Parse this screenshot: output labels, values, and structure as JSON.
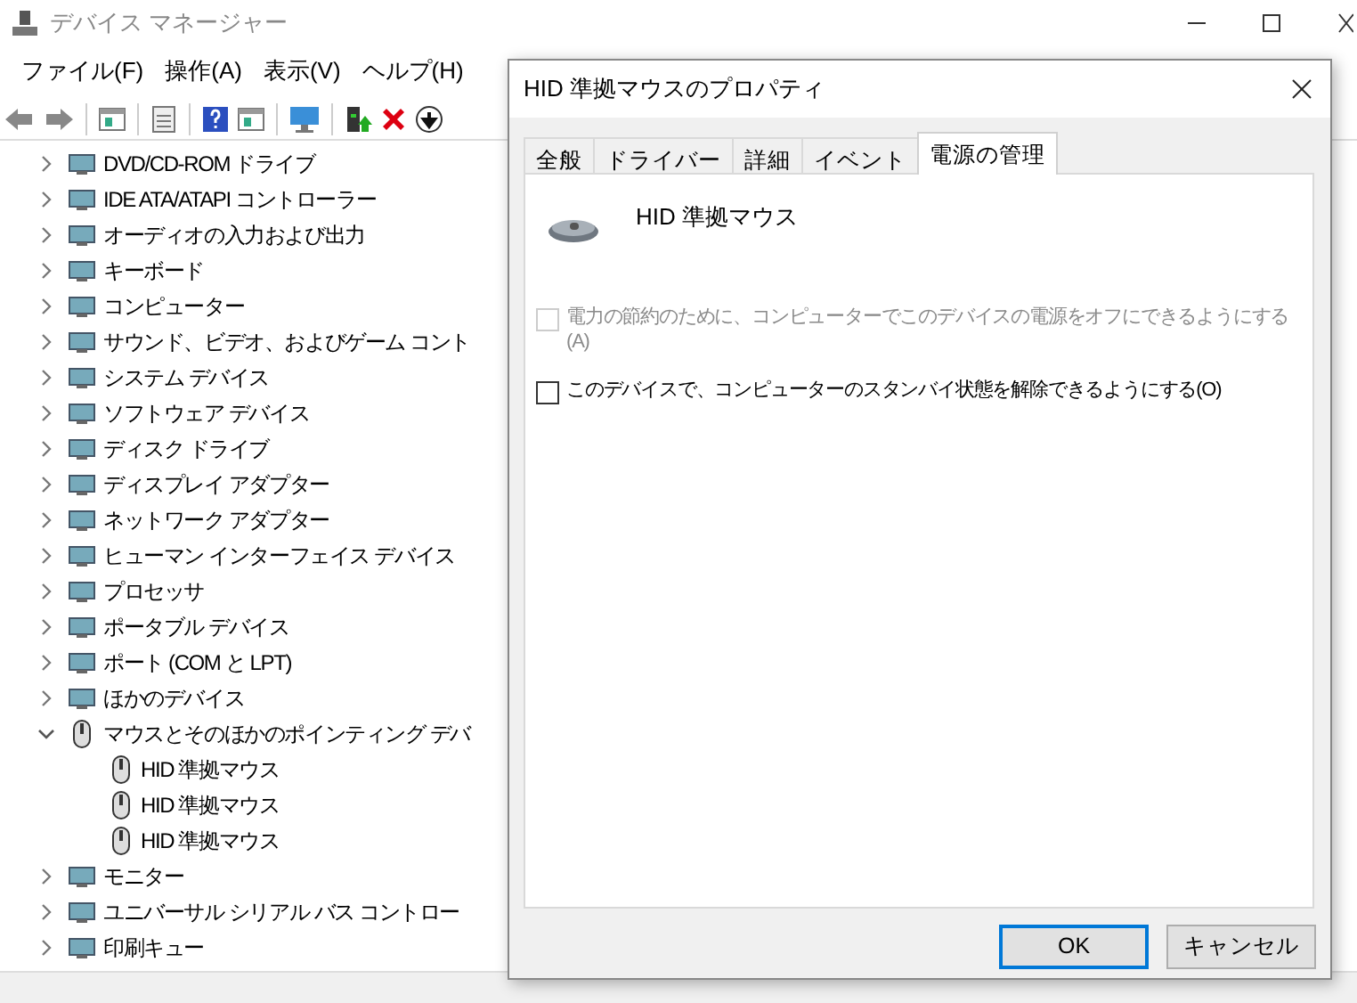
{
  "window": {
    "title": "デバイス マネージャー"
  },
  "menu": [
    "ファイル(F)",
    "操作(A)",
    "表示(V)",
    "ヘルプ(H)"
  ],
  "tree": [
    {
      "label": "DVD/CD-ROM ドライブ",
      "expanded": false
    },
    {
      "label": "IDE ATA/ATAPI コントローラー",
      "expanded": false
    },
    {
      "label": "オーディオの入力および出力",
      "expanded": false
    },
    {
      "label": "キーボード",
      "expanded": false
    },
    {
      "label": "コンピューター",
      "expanded": false
    },
    {
      "label": "サウンド、ビデオ、およびゲーム コント",
      "expanded": false
    },
    {
      "label": "システム デバイス",
      "expanded": false
    },
    {
      "label": "ソフトウェア デバイス",
      "expanded": false
    },
    {
      "label": "ディスク ドライブ",
      "expanded": false
    },
    {
      "label": "ディスプレイ アダプター",
      "expanded": false
    },
    {
      "label": "ネットワーク アダプター",
      "expanded": false
    },
    {
      "label": "ヒューマン インターフェイス デバイス",
      "expanded": false
    },
    {
      "label": "プロセッサ",
      "expanded": false
    },
    {
      "label": "ポータブル デバイス",
      "expanded": false
    },
    {
      "label": "ポート (COM と LPT)",
      "expanded": false
    },
    {
      "label": "ほかのデバイス",
      "expanded": false
    },
    {
      "label": "マウスとそのほかのポインティング デバ",
      "expanded": true,
      "children": [
        {
          "label": "HID 準拠マウス"
        },
        {
          "label": "HID 準拠マウス"
        },
        {
          "label": "HID 準拠マウス"
        }
      ]
    },
    {
      "label": "モニター",
      "expanded": false
    },
    {
      "label": "ユニバーサル シリアル バス コントロー",
      "expanded": false
    },
    {
      "label": "印刷キュー",
      "expanded": false
    }
  ],
  "dialog": {
    "title": "HID 準拠マウスのプロパティ",
    "tabs": [
      {
        "label": "全般",
        "selected": false
      },
      {
        "label": "ドライバー",
        "selected": false
      },
      {
        "label": "詳細",
        "selected": false
      },
      {
        "label": "イベント",
        "selected": false
      },
      {
        "label": "電源の管理",
        "selected": true
      }
    ],
    "device_name": "HID 準拠マウス",
    "options": [
      {
        "label": "電力の節約のために、コンピューターでこのデバイスの電源をオフにできるようにする(A)",
        "checked": false,
        "disabled": true
      },
      {
        "label": "このデバイスで、コンピューターのスタンバイ状態を解除できるようにする(O)",
        "checked": false,
        "disabled": false
      }
    ],
    "buttons": [
      {
        "label": "OK",
        "default": true
      },
      {
        "label": "キャンセル",
        "default": false
      }
    ]
  }
}
